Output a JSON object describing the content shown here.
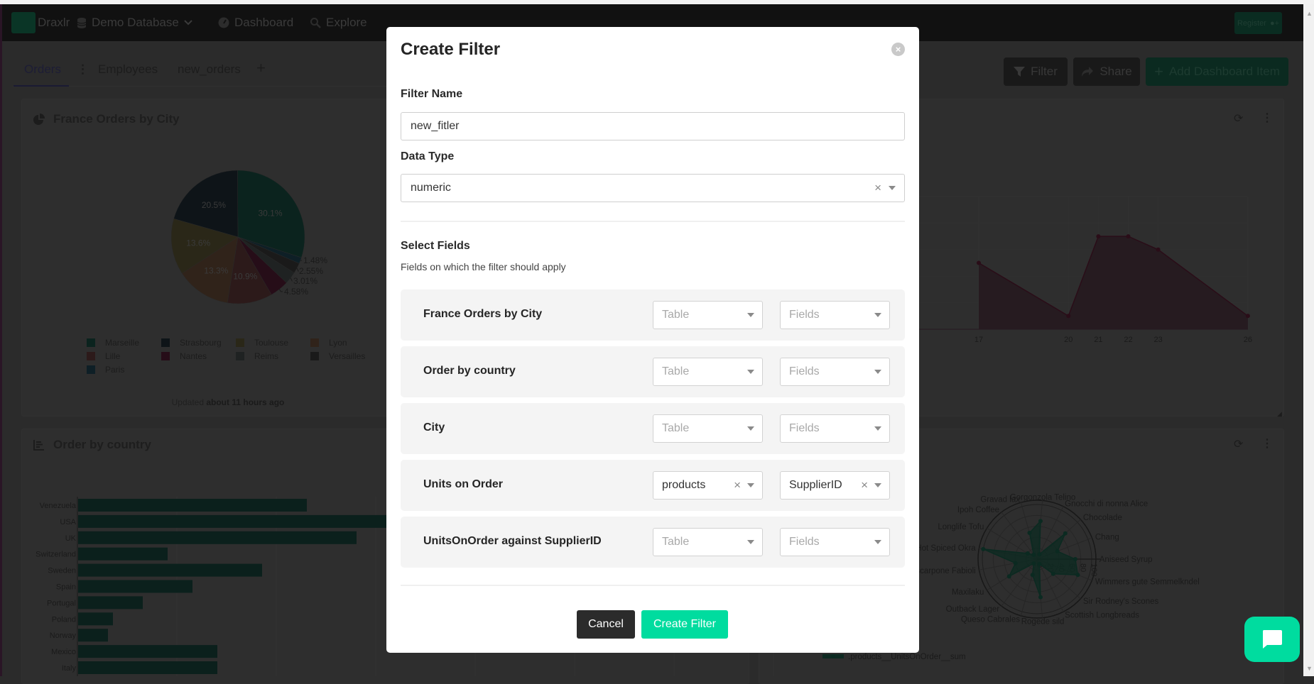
{
  "navbar": {
    "brand": "Draxlr",
    "database": "Demo Database",
    "dashboard": "Dashboard",
    "explore": "Explore",
    "register": "Register"
  },
  "tabs": [
    {
      "label": "Orders",
      "active": true
    },
    {
      "label": "Employees"
    },
    {
      "label": "new_orders"
    }
  ],
  "tab_add": "+",
  "toolbar": {
    "filter": "Filter",
    "share": "Share",
    "add_item": "Add Dashboard Item"
  },
  "cards": {
    "pie": {
      "title": "France Orders by City",
      "updated_prefix": "Updated",
      "updated_time": "about 11 hours ago"
    },
    "bar": {
      "title": "Order by country"
    }
  },
  "colors": {
    "accent": "#00dc9f",
    "overlay_dimmed_bar": "#0b201c",
    "area_fill": "#261b20",
    "area_line": "#2a0d18",
    "radar_fill": "#0e2a22"
  },
  "chart_data": [
    {
      "type": "pie",
      "title": "France Orders by City",
      "direction": "counterclockwise",
      "labels": [
        "Marseille",
        "Strasbourg",
        "Toulouse",
        "Lyon",
        "Lille",
        "Nantes",
        "Reims",
        "Versailles",
        "Paris"
      ],
      "values": [
        30.1,
        20.5,
        13.6,
        13.3,
        10.9,
        4.58,
        3.01,
        2.55,
        1.48
      ],
      "value_labels": [
        "30.1%",
        "20.5%",
        "13.6%",
        "13.3%",
        "10.9%",
        "4.58%",
        "3.01%",
        "2.55%",
        "1.48%"
      ],
      "colors": [
        "#0b231e",
        "#0e1418",
        "#2a2718",
        "#30231a",
        "#2c1a1a",
        "#260d18",
        "#1f2222",
        "#1a1a1a",
        "#0e1f26"
      ],
      "legend": "bottom"
    },
    {
      "type": "bar",
      "orientation": "horizontal",
      "title": "Order by country",
      "categories": [
        "Venezuela",
        "USA",
        "UK",
        "Switzerland",
        "Sweden",
        "Spain",
        "Portugal",
        "Poland",
        "Norway",
        "Mexico",
        "Italy"
      ],
      "values": [
        46,
        122,
        56,
        18,
        37,
        23,
        13,
        7,
        6,
        28,
        28
      ],
      "grid": true
    },
    {
      "type": "area",
      "x": [
        17,
        20,
        21,
        22,
        23,
        26
      ],
      "y": [
        5,
        1,
        7,
        7,
        6,
        1
      ],
      "xticks": [
        "17",
        "20",
        "21",
        "22",
        "23",
        "26"
      ],
      "ylim": [
        0,
        10
      ],
      "grid": true
    },
    {
      "type": "radar",
      "categories": [
        "Aniseed Syrup",
        "Chang",
        "Chocolade",
        "Gnocchi di nonna Alice",
        "Gorgonzola Telino",
        "Gravad lax",
        "Ipoh Coffee",
        "Longlife Tofu",
        "Louisiana Hot Spiced Okra",
        "Mascarpone Fabioli",
        "Maxilaku",
        "Outback Lager",
        "Queso Cabrales",
        "Rogede sild",
        "Scottish Longbreads",
        "Sir Rodney's Scones",
        "Wimmers gute Semmelkndel"
      ],
      "series": [
        {
          "name": ".products__UnitsOnOrder__sum",
          "values": [
            70,
            40,
            70,
            10,
            70,
            50,
            10,
            20,
            100,
            40,
            60,
            10,
            30,
            70,
            10,
            40,
            80
          ]
        }
      ],
      "rticks": [
        "0",
        "20",
        "40",
        "60",
        "80",
        "100"
      ],
      "rlim": [
        0,
        100
      ],
      "legend": "bottom"
    }
  ],
  "modal": {
    "title": "Create Filter",
    "filter_name_label": "Filter Name",
    "filter_name_value": "new_fitler",
    "data_type_label": "Data Type",
    "data_type_value": "numeric",
    "select_fields_title": "Select Fields",
    "select_fields_subtitle": "Fields on which the filter should apply",
    "table_placeholder": "Table",
    "fields_placeholder": "Fields",
    "rows": [
      {
        "label": "France Orders by City"
      },
      {
        "label": "Order by country"
      },
      {
        "label": "City"
      },
      {
        "label": "Units on Order",
        "table": "products",
        "field": "SupplierID"
      },
      {
        "label": "UnitsOnOrder against SupplierID"
      }
    ],
    "cancel": "Cancel",
    "create": "Create Filter"
  }
}
